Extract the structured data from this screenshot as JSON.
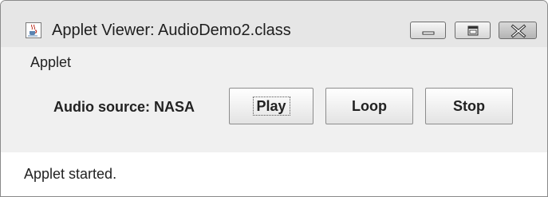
{
  "window": {
    "title": "Applet Viewer: AudioDemo2.class",
    "app_icon": "java-cup-icon",
    "controls": [
      "minimize-icon",
      "maximize-icon",
      "close-icon"
    ]
  },
  "menubar": {
    "items": [
      {
        "label": "Applet"
      }
    ]
  },
  "applet": {
    "audio_label": "Audio source: NASA",
    "buttons": {
      "play": "Play",
      "loop": "Loop",
      "stop": "Stop"
    }
  },
  "status": {
    "text": "Applet started."
  },
  "colors": {
    "titlebar": "#e6e6e6",
    "content_bg": "#f0f0f0",
    "status_bg": "#ffffff"
  }
}
